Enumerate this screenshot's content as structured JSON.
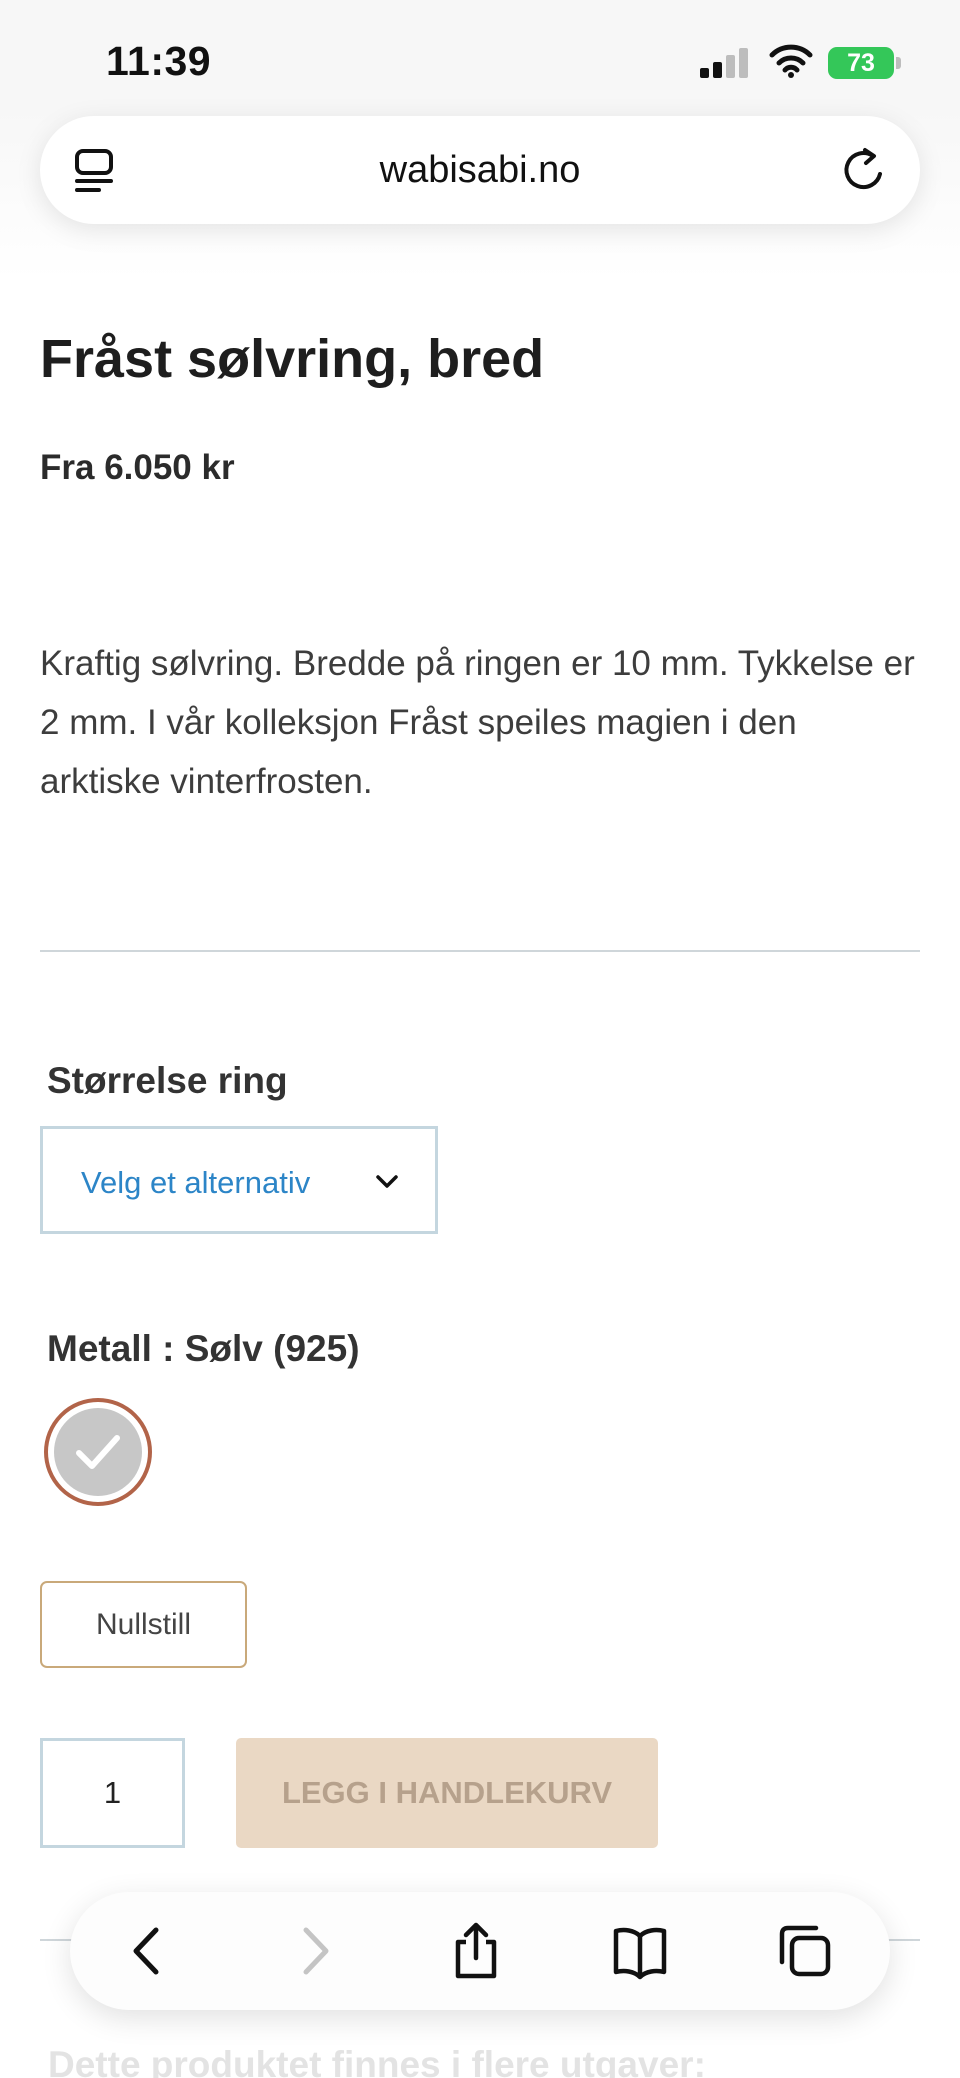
{
  "status_bar": {
    "time": "11:39",
    "battery": "73"
  },
  "browser": {
    "url": "wabisabi.no"
  },
  "product": {
    "title": "Fråst sølvring, bred",
    "price": "Fra 6.050 kr",
    "description": "Kraftig sølvring. Bredde på ringen er 10 mm. Tykkelse er 2 mm. I vår kolleksjon Fråst speiles magien i den arktiske vinterfrosten."
  },
  "options": {
    "size_label": "Størrelse ring",
    "size_placeholder": "Velg et alternativ",
    "metal_label": "Metall : Sølv (925)",
    "reset_label": "Nullstill"
  },
  "cart": {
    "quantity": "1",
    "add_label": "LEGG I HANDLEKURV"
  },
  "variants": {
    "heading": "Dette produktet finnes i flere utgaver:"
  },
  "colors": {
    "accent_link": "#2c85c7",
    "swatch_border": "#b26449",
    "reset_border": "#c9a97a",
    "cart_button_bg": "#ead8c4",
    "cart_button_text": "#b6a18c",
    "battery": "#34c759"
  },
  "icons": {
    "reader": "reader-mode-icon",
    "reload": "reload-icon",
    "chevron": "chevron-down-icon",
    "check": "check-icon",
    "back": "back-arrow-icon",
    "forward": "forward-arrow-icon",
    "share": "share-icon",
    "bookmarks": "bookmarks-icon",
    "tabs": "tabs-icon"
  }
}
